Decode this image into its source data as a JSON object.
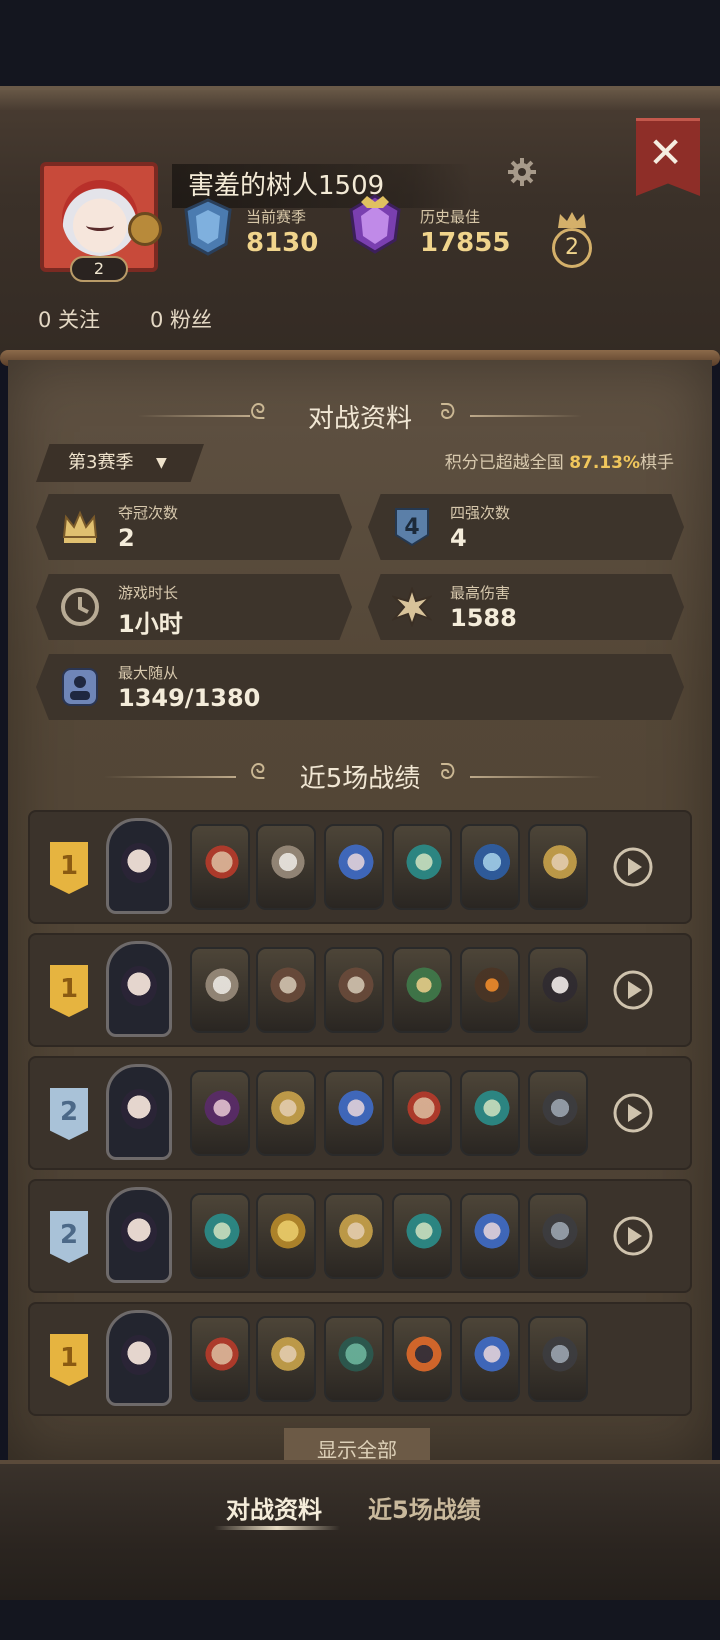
{
  "profile": {
    "name": "害羞的树人1509",
    "level": "2",
    "current_season_label": "当前赛季",
    "current_season_value": "8130",
    "best_label": "历史最佳",
    "best_value": "17855",
    "best_count": "2",
    "following": "0 关注",
    "followers": "0 粉丝"
  },
  "battle": {
    "title": "对战资料",
    "season": "第3赛季",
    "percent_prefix": "积分已超越全国 ",
    "percent_value": "87.13%",
    "percent_suffix": "棋手",
    "stats": [
      {
        "label": "夺冠次数",
        "value": "2",
        "icon": "crown-icon"
      },
      {
        "label": "四强次数",
        "value": "4",
        "icon": "top4-shield-icon"
      },
      {
        "label": "游戏时长",
        "value": "1小时",
        "icon": "clock-icon"
      },
      {
        "label": "最高伤害",
        "value": "1588",
        "icon": "damage-burst-icon"
      },
      {
        "label": "最大随从",
        "value": "1349/1380",
        "icon": "minion-icon"
      }
    ]
  },
  "recent": {
    "title": "近5场战绩",
    "matches": [
      {
        "place": "1",
        "place_color": "#e6b440"
      },
      {
        "place": "1",
        "place_color": "#e6b440"
      },
      {
        "place": "2",
        "place_color": "#a9c2d8"
      },
      {
        "place": "2",
        "place_color": "#a9c2d8"
      },
      {
        "place": "1",
        "place_color": "#e6b440"
      }
    ],
    "show_all": "显示全部"
  },
  "tabs": {
    "battle": "对战资料",
    "recent": "近5场战绩"
  },
  "colors": {
    "accent_gold": "#f0c65c",
    "close_red": "#8e2e28"
  }
}
